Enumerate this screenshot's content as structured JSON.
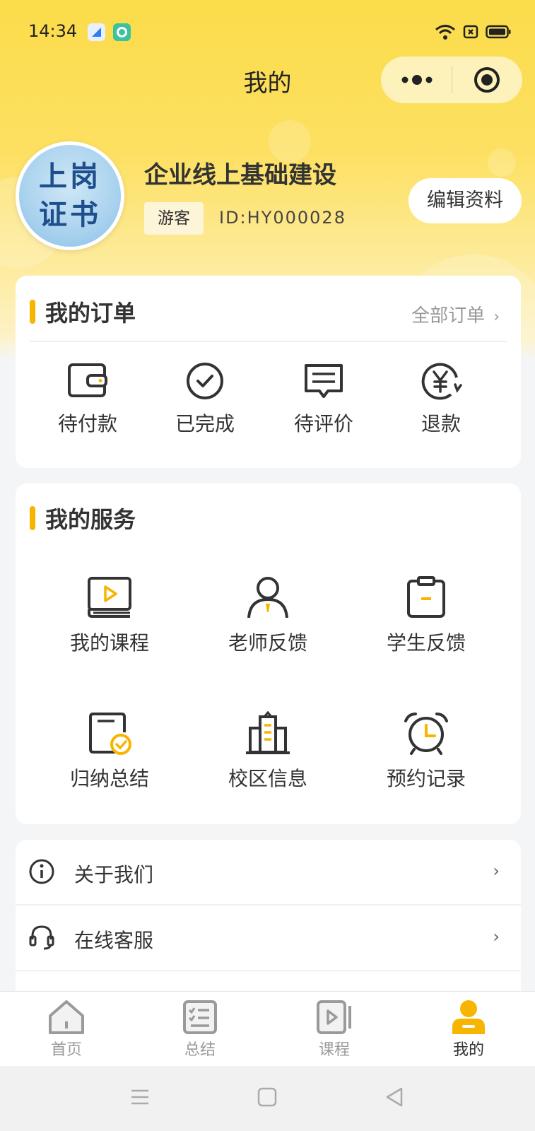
{
  "status_bar": {
    "time": "14:34"
  },
  "nav": {
    "title": "我的"
  },
  "profile": {
    "avatar_text": [
      "上岗",
      "证书"
    ],
    "name": "企业线上基础建设",
    "role": "游客",
    "id": "ID:HY000028",
    "edit_label": "编辑资料"
  },
  "orders": {
    "title": "我的订单",
    "all_label": "全部订单",
    "items": [
      {
        "label": "待付款",
        "icon": "wallet-icon"
      },
      {
        "label": "已完成",
        "icon": "check-circle-icon"
      },
      {
        "label": "待评价",
        "icon": "comment-icon"
      },
      {
        "label": "退款",
        "icon": "yen-refund-icon"
      }
    ]
  },
  "services": {
    "title": "我的服务",
    "items": [
      {
        "label": "我的课程",
        "icon": "course-video-icon"
      },
      {
        "label": "老师反馈",
        "icon": "teacher-icon"
      },
      {
        "label": "学生反馈",
        "icon": "clipboard-icon"
      },
      {
        "label": "归纳总结",
        "icon": "summary-icon"
      },
      {
        "label": "校区信息",
        "icon": "building-icon"
      },
      {
        "label": "预约记录",
        "icon": "alarm-clock-icon"
      }
    ]
  },
  "menu": [
    {
      "label": "关于我们",
      "icon": "info-icon",
      "arrow": "›"
    },
    {
      "label": "在线客服",
      "icon": "headset-icon",
      "arrow": "›"
    }
  ],
  "tabbar": [
    {
      "label": "首页",
      "icon": "home-icon",
      "active": false
    },
    {
      "label": "总结",
      "icon": "checklist-icon",
      "active": false
    },
    {
      "label": "课程",
      "icon": "video-icon",
      "active": false
    },
    {
      "label": "我的",
      "icon": "user-icon",
      "active": true
    }
  ],
  "colors": {
    "accent": "#f7b500",
    "header_yellow": "#fbdc4a",
    "background": "#f4f5f7"
  }
}
